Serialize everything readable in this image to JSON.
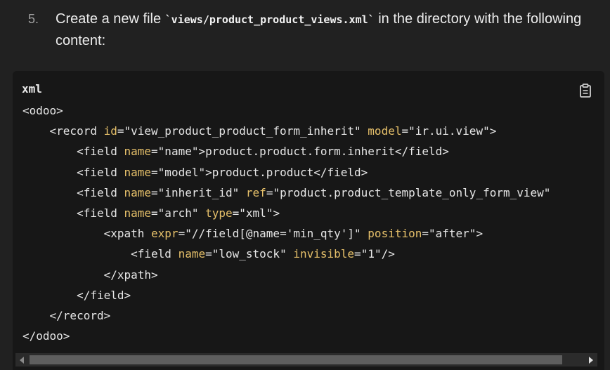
{
  "step": {
    "number": "5.",
    "text_before": "Create a new file ",
    "filename": "`views/product_product_views.xml`",
    "text_after": " in the directory with the following content:"
  },
  "code_block": {
    "language": "xml",
    "copy_icon": "clipboard-icon",
    "lines": [
      [
        {
          "t": "tag",
          "v": "<odoo>"
        }
      ],
      [
        {
          "t": "tag",
          "v": "    <record "
        },
        {
          "t": "attr",
          "v": "id"
        },
        {
          "t": "tag",
          "v": "="
        },
        {
          "t": "str",
          "v": "\"view_product_product_form_inherit\""
        },
        {
          "t": "tag",
          "v": " "
        },
        {
          "t": "attr",
          "v": "model"
        },
        {
          "t": "tag",
          "v": "="
        },
        {
          "t": "str",
          "v": "\"ir.ui.view\""
        },
        {
          "t": "tag",
          "v": ">"
        }
      ],
      [
        {
          "t": "tag",
          "v": "        <field "
        },
        {
          "t": "attr",
          "v": "name"
        },
        {
          "t": "tag",
          "v": "="
        },
        {
          "t": "str",
          "v": "\"name\""
        },
        {
          "t": "tag",
          "v": ">product.product.form.inherit</field>"
        }
      ],
      [
        {
          "t": "tag",
          "v": "        <field "
        },
        {
          "t": "attr",
          "v": "name"
        },
        {
          "t": "tag",
          "v": "="
        },
        {
          "t": "str",
          "v": "\"model\""
        },
        {
          "t": "tag",
          "v": ">product.product</field>"
        }
      ],
      [
        {
          "t": "tag",
          "v": "        <field "
        },
        {
          "t": "attr",
          "v": "name"
        },
        {
          "t": "tag",
          "v": "="
        },
        {
          "t": "str",
          "v": "\"inherit_id\""
        },
        {
          "t": "tag",
          "v": " "
        },
        {
          "t": "attr",
          "v": "ref"
        },
        {
          "t": "tag",
          "v": "="
        },
        {
          "t": "str",
          "v": "\"product.product_template_only_form_view\""
        }
      ],
      [
        {
          "t": "tag",
          "v": "        <field "
        },
        {
          "t": "attr",
          "v": "name"
        },
        {
          "t": "tag",
          "v": "="
        },
        {
          "t": "str",
          "v": "\"arch\""
        },
        {
          "t": "tag",
          "v": " "
        },
        {
          "t": "attr",
          "v": "type"
        },
        {
          "t": "tag",
          "v": "="
        },
        {
          "t": "str",
          "v": "\"xml\""
        },
        {
          "t": "tag",
          "v": ">"
        }
      ],
      [
        {
          "t": "tag",
          "v": "            <xpath "
        },
        {
          "t": "attr",
          "v": "expr"
        },
        {
          "t": "tag",
          "v": "="
        },
        {
          "t": "str",
          "v": "\"//field[@name='min_qty']\""
        },
        {
          "t": "tag",
          "v": " "
        },
        {
          "t": "attr",
          "v": "position"
        },
        {
          "t": "tag",
          "v": "="
        },
        {
          "t": "str",
          "v": "\"after\""
        },
        {
          "t": "tag",
          "v": ">"
        }
      ],
      [
        {
          "t": "tag",
          "v": "                <field "
        },
        {
          "t": "attr",
          "v": "name"
        },
        {
          "t": "tag",
          "v": "="
        },
        {
          "t": "str",
          "v": "\"low_stock\""
        },
        {
          "t": "tag",
          "v": " "
        },
        {
          "t": "attr",
          "v": "invisible"
        },
        {
          "t": "tag",
          "v": "="
        },
        {
          "t": "str",
          "v": "\"1\""
        },
        {
          "t": "tag",
          "v": "/>"
        }
      ],
      [
        {
          "t": "tag",
          "v": "            </xpath>"
        }
      ],
      [
        {
          "t": "tag",
          "v": "        </field>"
        }
      ],
      [
        {
          "t": "tag",
          "v": "    </record>"
        }
      ],
      [
        {
          "t": "tag",
          "v": "</odoo>"
        }
      ]
    ]
  },
  "scrollbar": {
    "left_icon": "arrow-left-icon",
    "right_icon": "arrow-right-icon"
  }
}
